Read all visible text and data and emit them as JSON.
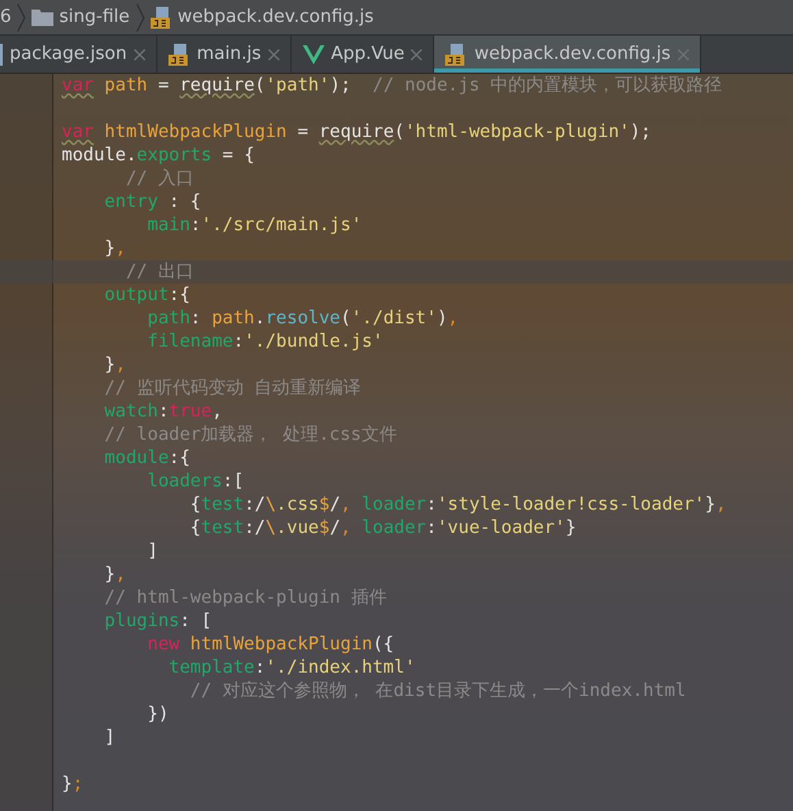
{
  "breadcrumb": [
    {
      "kind": "text",
      "text": "6"
    },
    {
      "kind": "folder",
      "text": "sing-file"
    },
    {
      "kind": "js",
      "text": "webpack.dev.config.js"
    }
  ],
  "tabs": [
    {
      "kind": "json",
      "label": "package.json",
      "selected": false
    },
    {
      "kind": "js",
      "label": "main.js",
      "selected": false
    },
    {
      "kind": "vue",
      "label": "App.Vue",
      "selected": false
    },
    {
      "kind": "js",
      "label": "webpack.dev.config.js",
      "selected": true
    }
  ],
  "lines": [
    {
      "current": false,
      "tokens": [
        {
          "kind": "keyword-warn",
          "text": "var"
        },
        {
          "kind": "ident",
          "text": " path"
        },
        {
          "kind": "plain",
          "text": " = "
        },
        {
          "kind": "call-warn",
          "text": "require"
        },
        {
          "kind": "plain",
          "text": "("
        },
        {
          "kind": "string",
          "text": "'path'"
        },
        {
          "kind": "plain",
          "text": ");"
        },
        {
          "kind": "comment",
          "text": "  // node.js 中的内置模块，可以获取路径"
        }
      ]
    },
    {
      "current": false
    },
    {
      "current": false,
      "tokens": [
        {
          "kind": "keyword-warn",
          "text": "var"
        },
        {
          "kind": "ident",
          "text": " htmlWebpackPlugin"
        },
        {
          "kind": "plain",
          "text": " = "
        },
        {
          "kind": "call-warn",
          "text": "require"
        },
        {
          "kind": "plain",
          "text": "("
        },
        {
          "kind": "string",
          "text": "'html-webpack-plugin'"
        },
        {
          "kind": "plain",
          "text": ");"
        }
      ]
    },
    {
      "current": false,
      "tokens": [
        {
          "kind": "plain",
          "text": "module."
        },
        {
          "kind": "prop",
          "text": "exports"
        },
        {
          "kind": "plain",
          "text": " = {"
        }
      ]
    },
    {
      "current": false,
      "tokens": [
        {
          "kind": "comment",
          "text": "      // 入口"
        }
      ]
    },
    {
      "current": false,
      "tokens": [
        {
          "kind": "prop",
          "text": "    entry"
        },
        {
          "kind": "plain",
          "text": " : {"
        }
      ]
    },
    {
      "current": false,
      "tokens": [
        {
          "kind": "prop",
          "text": "        main"
        },
        {
          "kind": "plain",
          "text": ":"
        },
        {
          "kind": "string",
          "text": "'./src/main.js'"
        }
      ]
    },
    {
      "current": false,
      "tokens": [
        {
          "kind": "plain",
          "text": "    }"
        },
        {
          "kind": "punct",
          "text": ","
        }
      ]
    },
    {
      "current": true,
      "tokens": [
        {
          "kind": "comment",
          "text": "      // 出口"
        }
      ]
    },
    {
      "current": false,
      "tokens": [
        {
          "kind": "prop",
          "text": "    output"
        },
        {
          "kind": "plain",
          "text": ":{"
        }
      ]
    },
    {
      "current": false,
      "tokens": [
        {
          "kind": "prop",
          "text": "        path"
        },
        {
          "kind": "plain",
          "text": ": "
        },
        {
          "kind": "ident",
          "text": "path"
        },
        {
          "kind": "plain",
          "text": "."
        },
        {
          "kind": "func",
          "text": "resolve"
        },
        {
          "kind": "plain",
          "text": "("
        },
        {
          "kind": "string",
          "text": "'./dist'"
        },
        {
          "kind": "plain",
          "text": ")"
        },
        {
          "kind": "punct",
          "text": ","
        }
      ]
    },
    {
      "current": false,
      "tokens": [
        {
          "kind": "prop",
          "text": "        filename"
        },
        {
          "kind": "plain",
          "text": ":"
        },
        {
          "kind": "string",
          "text": "'./bundle.js'"
        }
      ]
    },
    {
      "current": false,
      "tokens": [
        {
          "kind": "plain",
          "text": "    }"
        },
        {
          "kind": "punct",
          "text": ","
        }
      ]
    },
    {
      "current": false,
      "tokens": [
        {
          "kind": "comment",
          "text": "    // 监听代码变动 自动重新编译"
        }
      ]
    },
    {
      "current": false,
      "tokens": [
        {
          "kind": "prop",
          "text": "    watch"
        },
        {
          "kind": "plain",
          "text": ":"
        },
        {
          "kind": "keyword",
          "text": "true"
        },
        {
          "kind": "plain",
          "text": ","
        }
      ]
    },
    {
      "current": false,
      "tokens": [
        {
          "kind": "comment",
          "text": "    // loader加载器， 处理.css文件"
        }
      ]
    },
    {
      "current": false,
      "tokens": [
        {
          "kind": "prop",
          "text": "    module"
        },
        {
          "kind": "plain",
          "text": ":{"
        }
      ]
    },
    {
      "current": false,
      "tokens": [
        {
          "kind": "prop",
          "text": "        loaders"
        },
        {
          "kind": "plain",
          "text": ":["
        }
      ]
    },
    {
      "current": false,
      "tokens": [
        {
          "kind": "plain",
          "text": "            {"
        },
        {
          "kind": "prop",
          "text": "test"
        },
        {
          "kind": "plain",
          "text": ":/"
        },
        {
          "kind": "ident",
          "text": "\\"
        },
        {
          "kind": "string",
          "text": ".css"
        },
        {
          "kind": "ident",
          "text": "$"
        },
        {
          "kind": "plain",
          "text": "/"
        },
        {
          "kind": "punct",
          "text": ", "
        },
        {
          "kind": "prop",
          "text": "loader"
        },
        {
          "kind": "plain",
          "text": ":"
        },
        {
          "kind": "string",
          "text": "'style-loader!css-loader'"
        },
        {
          "kind": "plain",
          "text": "}"
        },
        {
          "kind": "punct",
          "text": ","
        }
      ]
    },
    {
      "current": false,
      "tokens": [
        {
          "kind": "plain",
          "text": "            {"
        },
        {
          "kind": "prop",
          "text": "test"
        },
        {
          "kind": "plain",
          "text": ":/"
        },
        {
          "kind": "ident",
          "text": "\\"
        },
        {
          "kind": "string",
          "text": ".vue"
        },
        {
          "kind": "ident",
          "text": "$"
        },
        {
          "kind": "plain",
          "text": "/"
        },
        {
          "kind": "punct",
          "text": ", "
        },
        {
          "kind": "prop",
          "text": "loader"
        },
        {
          "kind": "plain",
          "text": ":"
        },
        {
          "kind": "string",
          "text": "'vue-loader'"
        },
        {
          "kind": "plain",
          "text": "}"
        }
      ]
    },
    {
      "current": false,
      "tokens": [
        {
          "kind": "plain",
          "text": "        ]"
        }
      ]
    },
    {
      "current": false,
      "tokens": [
        {
          "kind": "plain",
          "text": "    }"
        },
        {
          "kind": "punct",
          "text": ","
        }
      ]
    },
    {
      "current": false,
      "tokens": [
        {
          "kind": "comment",
          "text": "    // html-webpack-plugin 插件"
        }
      ]
    },
    {
      "current": false,
      "tokens": [
        {
          "kind": "prop",
          "text": "    plugins"
        },
        {
          "kind": "plain",
          "text": ": ["
        }
      ]
    },
    {
      "current": false,
      "tokens": [
        {
          "kind": "keyword",
          "text": "        new"
        },
        {
          "kind": "ident",
          "text": " htmlWebpackPlugin"
        },
        {
          "kind": "plain",
          "text": "({"
        }
      ]
    },
    {
      "current": false,
      "tokens": [
        {
          "kind": "prop",
          "text": "          template"
        },
        {
          "kind": "plain",
          "text": ":"
        },
        {
          "kind": "string",
          "text": "'./index.html'"
        }
      ]
    },
    {
      "current": false,
      "tokens": [
        {
          "kind": "comment",
          "text": "            // 对应这个参照物， 在dist目录下生成，一个index.html"
        }
      ]
    },
    {
      "current": false,
      "tokens": [
        {
          "kind": "plain",
          "text": "        })"
        }
      ]
    },
    {
      "current": false,
      "tokens": [
        {
          "kind": "plain",
          "text": "    ]"
        }
      ]
    },
    {
      "current": false
    },
    {
      "current": false,
      "tokens": [
        {
          "kind": "plain",
          "text": "}"
        },
        {
          "kind": "punct",
          "text": ";"
        }
      ]
    }
  ]
}
